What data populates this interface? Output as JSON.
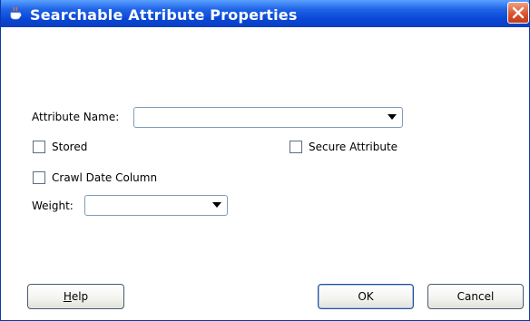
{
  "window": {
    "title": "Searchable Attribute Properties"
  },
  "form": {
    "attribute_name_label": "Attribute Name:",
    "attribute_name_value": "",
    "stored_label": "Stored",
    "stored_checked": false,
    "secure_attribute_label": "Secure Attribute",
    "secure_attribute_checked": false,
    "crawl_date_column_label": "Crawl Date Column",
    "crawl_date_column_checked": false,
    "weight_label": "Weight:",
    "weight_value": ""
  },
  "buttons": {
    "help_prefix": "H",
    "help_rest": "elp",
    "ok": "OK",
    "cancel": "Cancel"
  },
  "colors": {
    "title_bar": "#0a47d6",
    "close_button": "#d9502a",
    "field_border": "#7f9db9"
  },
  "icons": {
    "title": "oracle-cup-icon",
    "close": "close-icon",
    "dropdown": "chevron-down-icon"
  }
}
